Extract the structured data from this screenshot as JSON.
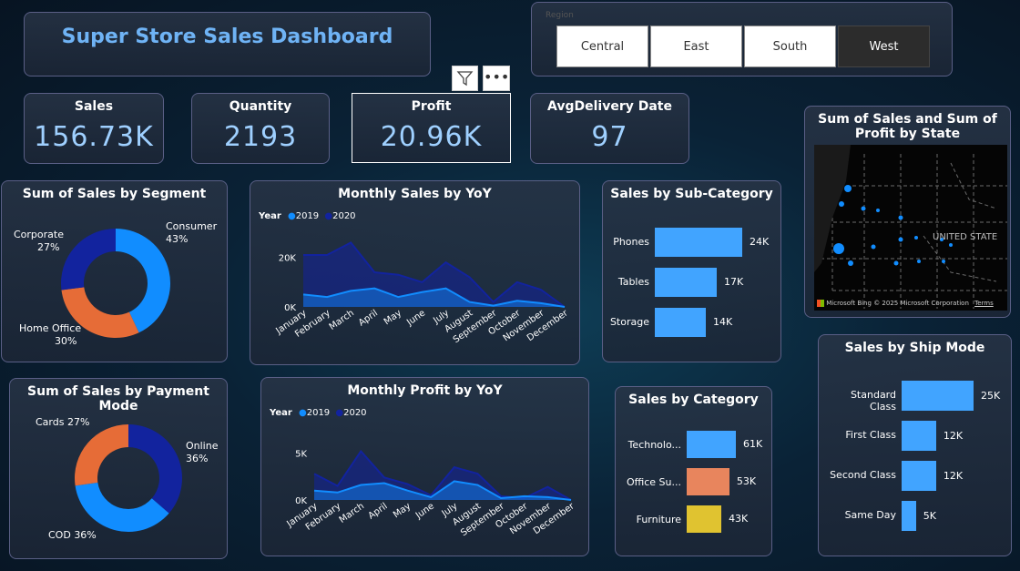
{
  "title": "Super Store Sales Dashboard",
  "region": {
    "label": "Region",
    "options": [
      "Central",
      "East",
      "South",
      "West"
    ],
    "selected": "West"
  },
  "kpis": [
    {
      "label": "Sales",
      "value": "156.73K"
    },
    {
      "label": "Quantity",
      "value": "2193"
    },
    {
      "label": "Profit",
      "value": "20.96K"
    },
    {
      "label": "AvgDelivery Date",
      "value": "97"
    }
  ],
  "colors": {
    "accent": "#118dff",
    "dark_blue": "#12239e",
    "orange": "#e66c37",
    "yellow": "#e0c330",
    "salmon": "#e8855d",
    "title_blue": "#6fb3f5"
  },
  "segment_chart": {
    "title": "Sum of Sales by Segment",
    "labels": [
      {
        "name": "Consumer",
        "pct": "43%"
      },
      {
        "name": "Home Office",
        "pct": "30%"
      },
      {
        "name": "Corporate",
        "pct": "27%"
      }
    ]
  },
  "payment_chart": {
    "title": "Sum of Sales by Payment Mode",
    "labels": [
      {
        "name": "Online",
        "pct": "36%"
      },
      {
        "name": "COD",
        "pct": "36%"
      },
      {
        "name": "Cards",
        "pct": "27%"
      }
    ]
  },
  "monthly_sales": {
    "title": "Monthly Sales by YoY",
    "legend_title": "Year",
    "y_ticks": [
      "20K",
      "0K"
    ]
  },
  "monthly_profit": {
    "title": "Monthly Profit by YoY",
    "legend_title": "Year",
    "y_ticks": [
      "5K",
      "0K"
    ]
  },
  "subcategory": {
    "title": "Sales by Sub-Category"
  },
  "category": {
    "title": "Sales by Category"
  },
  "shipmode": {
    "title": "Sales by Ship Mode"
  },
  "map": {
    "title": "Sum of Sales and Sum of Profit by State",
    "country_label": "UNITED STATE",
    "attribution": "Microsoft Bing",
    "copyright": "© 2025 Microsoft Corporation",
    "terms": "Terms"
  },
  "chart_data": [
    {
      "type": "pie",
      "title": "Sum of Sales by Segment",
      "categories": [
        "Consumer",
        "Home Office",
        "Corporate"
      ],
      "values": [
        43,
        30,
        27
      ],
      "colors": [
        "#118dff",
        "#e66c37",
        "#12239e"
      ]
    },
    {
      "type": "pie",
      "title": "Sum of Sales by Payment Mode",
      "categories": [
        "Online",
        "COD",
        "Cards"
      ],
      "values": [
        36,
        36,
        27
      ],
      "colors": [
        "#12239e",
        "#118dff",
        "#e66c37"
      ]
    },
    {
      "type": "area",
      "title": "Monthly Sales by YoY",
      "x": [
        "January",
        "February",
        "March",
        "April",
        "May",
        "June",
        "July",
        "August",
        "September",
        "October",
        "November",
        "December"
      ],
      "series": [
        {
          "name": "2019",
          "color": "#118dff",
          "values": [
            5000,
            4000,
            6500,
            7500,
            4000,
            6000,
            7500,
            2000,
            500,
            2500,
            1500,
            0
          ]
        },
        {
          "name": "2020",
          "color": "#12239e",
          "values": [
            21000,
            21000,
            26000,
            14000,
            13000,
            10000,
            18000,
            12000,
            2000,
            10000,
            7000,
            0
          ]
        }
      ],
      "ylim": [
        0,
        28000
      ],
      "yticks": [
        "0K",
        "20K"
      ]
    },
    {
      "type": "area",
      "title": "Monthly Profit by YoY",
      "x": [
        "January",
        "February",
        "March",
        "April",
        "May",
        "June",
        "July",
        "August",
        "September",
        "October",
        "November",
        "December"
      ],
      "series": [
        {
          "name": "2019",
          "color": "#118dff",
          "values": [
            1000,
            800,
            1600,
            1800,
            1000,
            300,
            2000,
            1600,
            200,
            400,
            300,
            0
          ]
        },
        {
          "name": "2020",
          "color": "#12239e",
          "values": [
            2800,
            1500,
            5200,
            2400,
            1700,
            500,
            3500,
            2800,
            400,
            200,
            1400,
            0
          ]
        }
      ],
      "ylim": [
        0,
        7000
      ],
      "yticks": [
        "0K",
        "5K"
      ]
    },
    {
      "type": "bar",
      "title": "Sales by Sub-Category",
      "categories": [
        "Phones",
        "Tables",
        "Storage"
      ],
      "values": [
        24000,
        17000,
        14000
      ],
      "labels": [
        "24K",
        "17K",
        "14K"
      ]
    },
    {
      "type": "bar",
      "title": "Sales by Category",
      "categories": [
        "Technolo...",
        "Office Su...",
        "Furniture"
      ],
      "values": [
        61000,
        53000,
        43000
      ],
      "labels": [
        "61K",
        "53K",
        "43K"
      ],
      "colors": [
        "#41a4ff",
        "#e8855d",
        "#e0c330"
      ]
    },
    {
      "type": "bar",
      "title": "Sales by Ship Mode",
      "categories": [
        "Standard Class",
        "First Class",
        "Second Class",
        "Same Day"
      ],
      "values": [
        25000,
        12000,
        12000,
        5000
      ],
      "labels": [
        "25K",
        "12K",
        "12K",
        "5K"
      ]
    }
  ]
}
